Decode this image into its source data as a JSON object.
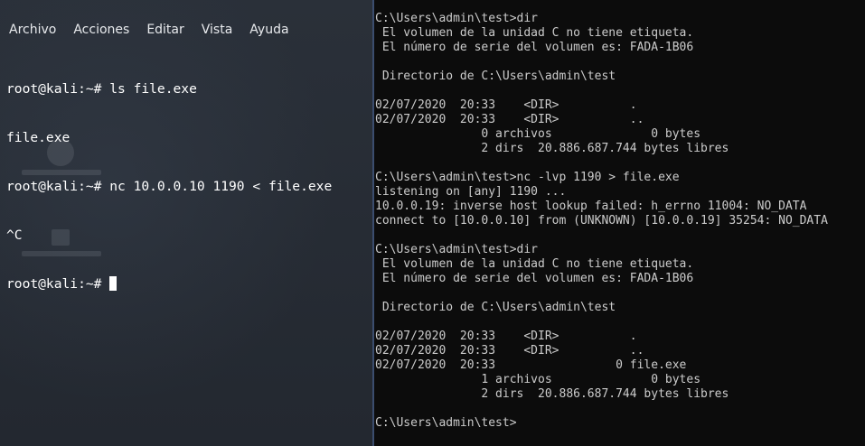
{
  "kali_window": {
    "menu": [
      "Archivo",
      "Acciones",
      "Editar",
      "Vista",
      "Ayuda"
    ],
    "terminal_lines": [
      "root@kali:~# ls file.exe",
      "file.exe",
      "root@kali:~# nc 10.0.0.10 1190 < file.exe",
      "^C"
    ],
    "prompt": "root@kali:~# "
  },
  "cmd_window": {
    "lines": [
      "C:\\Users\\admin\\test>dir",
      " El volumen de la unidad C no tiene etiqueta.",
      " El número de serie del volumen es: FADA-1B06",
      "",
      " Directorio de C:\\Users\\admin\\test",
      "",
      "02/07/2020  20:33    <DIR>          .",
      "02/07/2020  20:33    <DIR>          ..",
      "               0 archivos              0 bytes",
      "               2 dirs  20.886.687.744 bytes libres",
      "",
      "C:\\Users\\admin\\test>nc -lvp 1190 > file.exe",
      "listening on [any] 1190 ...",
      "10.0.0.19: inverse host lookup failed: h_errno 11004: NO_DATA",
      "connect to [10.0.0.10] from (UNKNOWN) [10.0.0.19] 35254: NO_DATA",
      "",
      "C:\\Users\\admin\\test>dir",
      " El volumen de la unidad C no tiene etiqueta.",
      " El número de serie del volumen es: FADA-1B06",
      "",
      " Directorio de C:\\Users\\admin\\test",
      "",
      "02/07/2020  20:33    <DIR>          .",
      "02/07/2020  20:33    <DIR>          ..",
      "02/07/2020  20:33                 0 file.exe",
      "               1 archivos              0 bytes",
      "               2 dirs  20.886.687.744 bytes libres",
      "",
      "C:\\Users\\admin\\test>"
    ]
  },
  "colors": {
    "kali_background": "#272c35",
    "cmd_background": "#0c0c0c",
    "cmd_text": "#cccccc",
    "kali_text": "#ffffff"
  }
}
